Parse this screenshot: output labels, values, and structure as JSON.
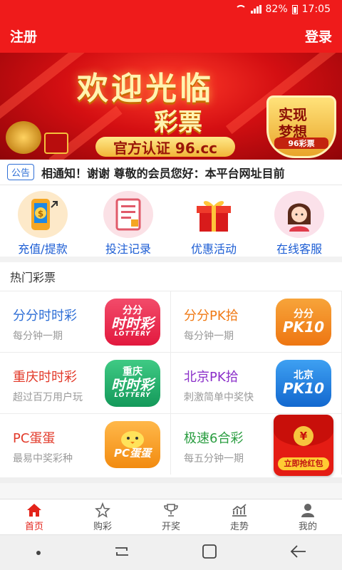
{
  "status_bar": {
    "battery": "82%",
    "time": "17:05"
  },
  "header": {
    "left_label": "注册",
    "right_label": "登录"
  },
  "banner": {
    "title": "欢迎光临",
    "subtitle": "彩票",
    "certification": "官方认证 96.cc",
    "badge_line1": "实现",
    "badge_line2": "梦想",
    "badge_brand": "96彩票"
  },
  "notice": {
    "tag": "公告",
    "text": "相通知！谢谢 尊敬的会员您好：本平台网址目前"
  },
  "quick_menu": [
    {
      "label": "充值/提款",
      "icon": "phone-money-icon"
    },
    {
      "label": "投注记录",
      "icon": "betting-record-icon"
    },
    {
      "label": "优惠活动",
      "icon": "gift-box-icon"
    },
    {
      "label": "在线客服",
      "icon": "customer-service-icon"
    }
  ],
  "section": {
    "hot_lottery_title": "热门彩票"
  },
  "lotteries": [
    {
      "name": "分分时时彩",
      "desc": "每分钟一期",
      "app_line1": "分分",
      "app_line2": "时时彩",
      "app_line3": "LOTTERY",
      "name_color": "#2f6fd6",
      "app_color": "#ec2b55"
    },
    {
      "name": "分分PK拾",
      "desc": "每分钟一期",
      "app_line1": "分分",
      "app_line2": "PK10",
      "app_line3": "",
      "name_color": "#f07a16",
      "app_color": "#f0861a"
    },
    {
      "name": "重庆时时彩",
      "desc": "超过百万用户玩",
      "app_line1": "重庆",
      "app_line2": "时时彩",
      "app_line3": "LOTTERY",
      "name_color": "#e23a2a",
      "app_color": "#20b06a"
    },
    {
      "name": "北京PK拾",
      "desc": "刺激简单中奖快",
      "app_line1": "北京",
      "app_line2": "PK10",
      "app_line3": "",
      "name_color": "#8b2fc9",
      "app_color": "#1d7fe0"
    },
    {
      "name": "PC蛋蛋",
      "desc": "最易中奖彩种",
      "app_line1": "",
      "app_line2": "PC蛋蛋",
      "app_line3": "",
      "name_color": "#e23a2a",
      "app_color": "#f59a16"
    },
    {
      "name": "极速6合彩",
      "desc": "每五分钟一期",
      "app_line1": "",
      "app_line2": "",
      "app_line3": "",
      "name_color": "#2a9d40",
      "app_color": "#ffffff"
    }
  ],
  "red_packet": {
    "coin": "¥",
    "button": "立即抢红包"
  },
  "tabbar": [
    {
      "label": "首页",
      "icon": "home-icon",
      "active": true
    },
    {
      "label": "购彩",
      "icon": "star-icon",
      "active": false
    },
    {
      "label": "开奖",
      "icon": "trophy-icon",
      "active": false
    },
    {
      "label": "走势",
      "icon": "trend-icon",
      "active": false
    },
    {
      "label": "我的",
      "icon": "user-icon",
      "active": false
    }
  ],
  "colors": {
    "primary_red": "#ef1b1b",
    "link_blue": "#1c5dd4",
    "active_tab": "#e3231a"
  }
}
